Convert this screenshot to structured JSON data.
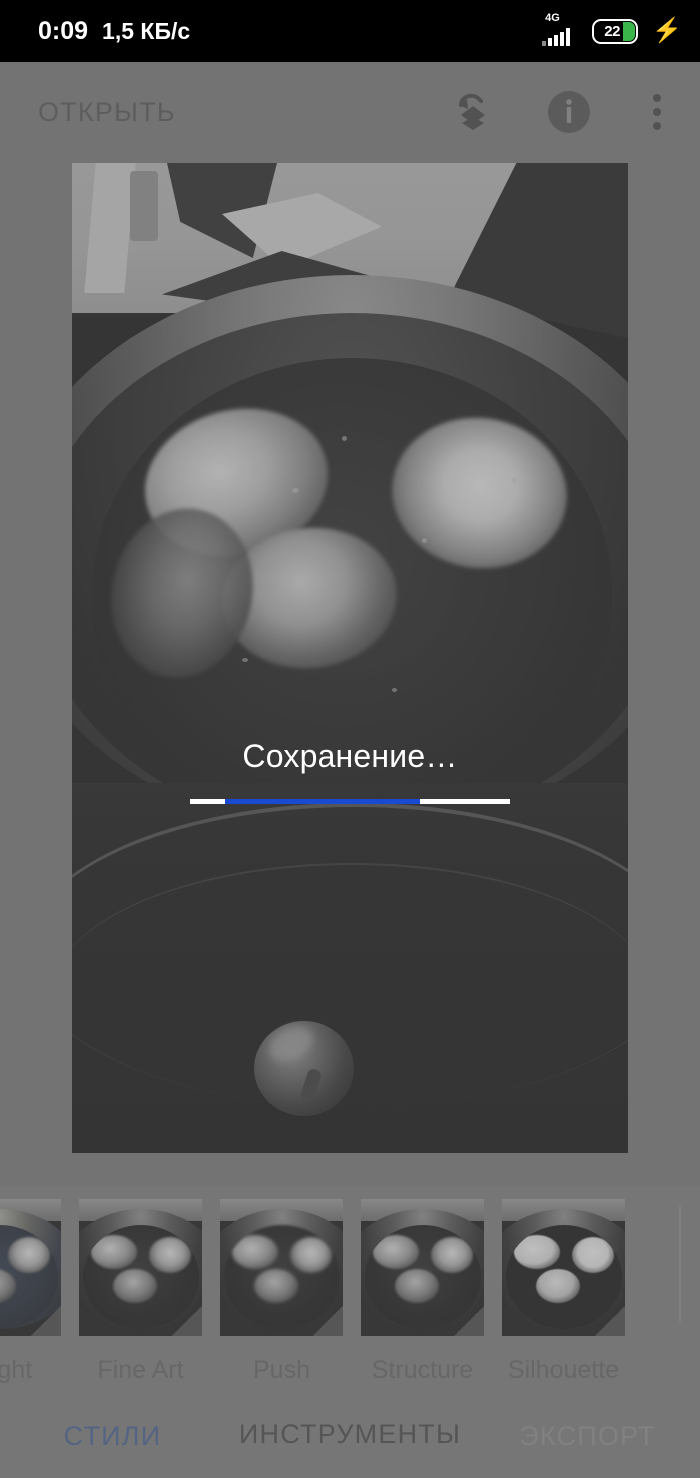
{
  "status_bar": {
    "clock": "0:09",
    "network_speed": "1,5 КБ/с",
    "network_type": "4G",
    "battery_percent": "22",
    "charging_icon": "bolt-icon",
    "signal_icon": "signal-bars-icon",
    "battery_fill_color": "#39b54a"
  },
  "appbar": {
    "open_label": "ОТКРЫТЬ",
    "undo_stack_icon": "undo-layers-icon",
    "info_icon": "info-icon",
    "menu_icon": "overflow-menu-icon"
  },
  "saving": {
    "text": "Сохранение…",
    "progress_color": "#1a4ad1",
    "track_color": "#ffffff"
  },
  "filters": {
    "items": [
      {
        "label": "Bright",
        "style": "tint-blue"
      },
      {
        "label": "Fine Art",
        "style": ""
      },
      {
        "label": "Push",
        "style": "soft"
      },
      {
        "label": "Structure",
        "style": ""
      },
      {
        "label": "Silhouette",
        "style": "tint-contrast"
      }
    ]
  },
  "tabs": [
    {
      "label": "СТИЛИ",
      "active": true,
      "color": "#3c5a91"
    },
    {
      "label": "ИНСТРУМЕНТЫ",
      "active": false,
      "color": "#3f3f3f"
    },
    {
      "label": "ЭКСПОРТ",
      "active": false,
      "color": "#8f8f8f"
    }
  ]
}
